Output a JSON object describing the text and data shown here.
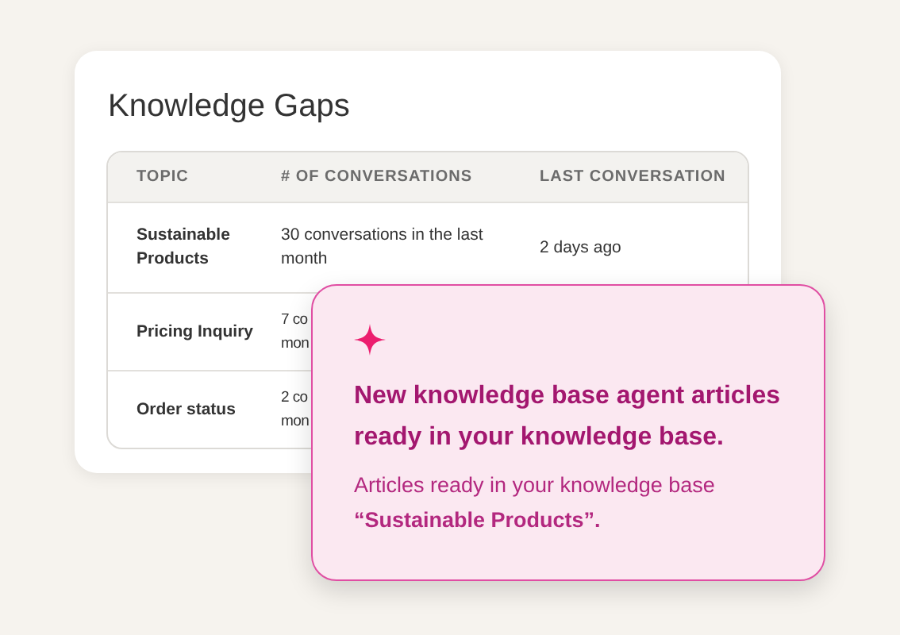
{
  "card": {
    "title": "Knowledge Gaps"
  },
  "table": {
    "columns": [
      "TOPIC",
      "# OF CONVERSATIONS",
      "LAST CONVERSATION"
    ],
    "rows": [
      {
        "cells": [
          "Sustainable Products",
          "30 conversations in the last month",
          "2 days ago"
        ]
      },
      {
        "cells": [
          "Pricing Inquiry",
          "7 co mon"
        ]
      },
      {
        "cells": [
          "Order status",
          "2 co mon"
        ]
      }
    ]
  },
  "notification": {
    "title": "New knowledge base agent articles ready in your knowledge base.",
    "message": "Articles ready in your knowledge base **“Sustainable Products”.**"
  }
}
